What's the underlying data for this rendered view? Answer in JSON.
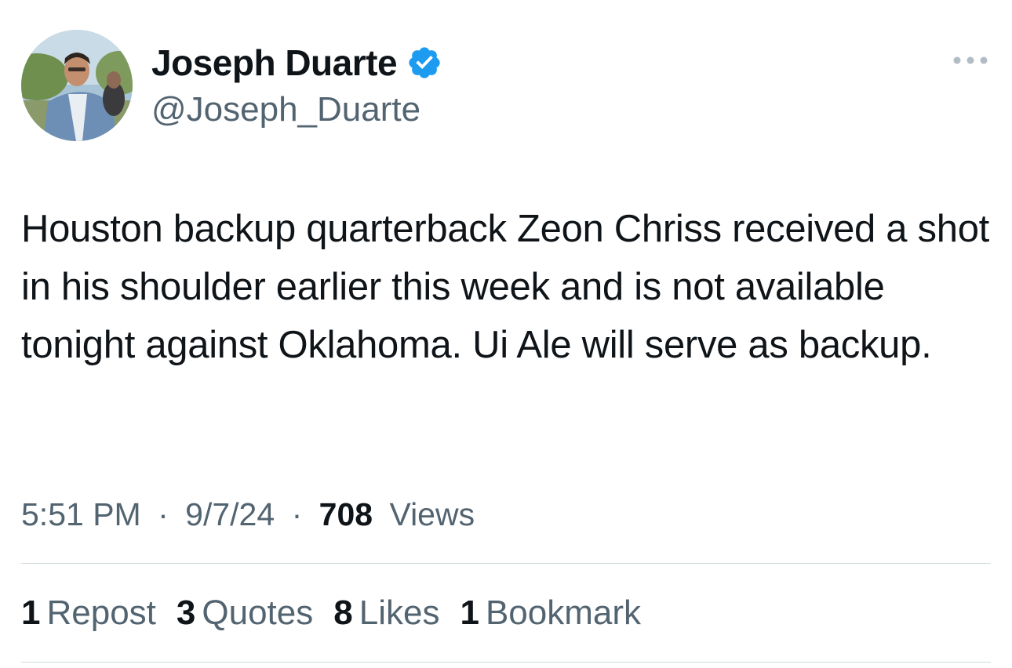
{
  "author": {
    "display_name": "Joseph Duarte",
    "handle": "@Joseph_Duarte",
    "verified_icon": "verified-badge-icon",
    "verified_color": "#1d9bf0"
  },
  "tweet": {
    "text": "Houston backup quarterback Zeon Chriss received a shot in his shoulder earlier this week and is not available tonight against Oklahoma. Ui Ale will serve as backup."
  },
  "meta": {
    "time": "5:51 PM",
    "separator": "·",
    "date": "9/7/24",
    "views_count": "708",
    "views_label": "Views"
  },
  "stats": {
    "reposts": {
      "count": "1",
      "label": "Repost"
    },
    "quotes": {
      "count": "3",
      "label": "Quotes"
    },
    "likes": {
      "count": "8",
      "label": "Likes"
    },
    "bookmarks": {
      "count": "1",
      "label": "Bookmark"
    }
  },
  "colors": {
    "text_primary": "#0f1419",
    "text_secondary": "#536471",
    "divider": "#cfd9de"
  }
}
